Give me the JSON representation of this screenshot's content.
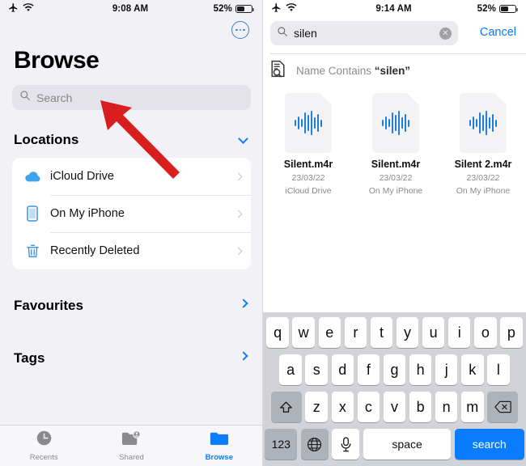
{
  "left": {
    "status": {
      "airplane_icon": "airplane-icon",
      "wifi_icon": "wifi-icon",
      "time": "9:08 AM",
      "battery_percent": "52%",
      "battery_level": 52
    },
    "more_button": "more-options-button",
    "title": "Browse",
    "search": {
      "placeholder": "Search",
      "icon": "search-icon"
    },
    "sections": [
      {
        "heading": "Locations",
        "chevron": "chevron-down-icon"
      },
      {
        "heading": "Favourites",
        "chevron": "chevron-right-icon"
      },
      {
        "heading": "Tags",
        "chevron": "chevron-right-icon"
      }
    ],
    "locations": [
      {
        "label": "iCloud Drive",
        "icon": "icloud-icon"
      },
      {
        "label": "On My iPhone",
        "icon": "iphone-icon"
      },
      {
        "label": "Recently Deleted",
        "icon": "trash-icon"
      }
    ],
    "tabs": [
      {
        "label": "Recents",
        "icon": "clock-icon",
        "active": false
      },
      {
        "label": "Shared",
        "icon": "shared-folder-icon",
        "active": false
      },
      {
        "label": "Browse",
        "icon": "folder-icon",
        "active": true
      }
    ],
    "annotation": {
      "arrow_color": "#d81f1f",
      "name": "red-arrow-pointing-to-search"
    }
  },
  "right": {
    "status": {
      "airplane_icon": "airplane-icon",
      "wifi_icon": "wifi-icon",
      "time": "9:14 AM",
      "battery_percent": "52%",
      "battery_level": 52
    },
    "search": {
      "value": "silen",
      "icon": "search-icon",
      "clear_icon": "clear-circle-icon"
    },
    "cancel_label": "Cancel",
    "scope": {
      "icon": "document-search-icon",
      "prefix": "Name Contains ",
      "quoted": "“silen”"
    },
    "results": [
      {
        "name": "Silent.m4r",
        "date": "23/03/22",
        "location": "iCloud Drive",
        "icon": "audio-file-icon"
      },
      {
        "name": "Silent.m4r",
        "date": "23/03/22",
        "location": "On My iPhone",
        "icon": "audio-file-icon"
      },
      {
        "name": "Silent 2.m4r",
        "date": "23/03/22",
        "location": "On My iPhone",
        "icon": "audio-file-icon"
      }
    ],
    "keyboard": {
      "row1": [
        "q",
        "w",
        "e",
        "r",
        "t",
        "y",
        "u",
        "i",
        "o",
        "p"
      ],
      "row2": [
        "a",
        "s",
        "d",
        "f",
        "g",
        "h",
        "j",
        "k",
        "l"
      ],
      "row3": [
        "z",
        "x",
        "c",
        "v",
        "b",
        "n",
        "m"
      ],
      "shift_icon": "shift-up-arrow-icon",
      "backspace_icon": "backspace-icon",
      "numbers_label": "123",
      "globe_icon": "globe-icon",
      "mic_icon": "microphone-icon",
      "space_label": "space",
      "return_label": "search"
    }
  },
  "colors": {
    "accent": "#0a7cff",
    "annotation": "#d81f1f",
    "panel_bg": "#f2f1f6",
    "keyboard_bg": "#d1d3d9"
  }
}
